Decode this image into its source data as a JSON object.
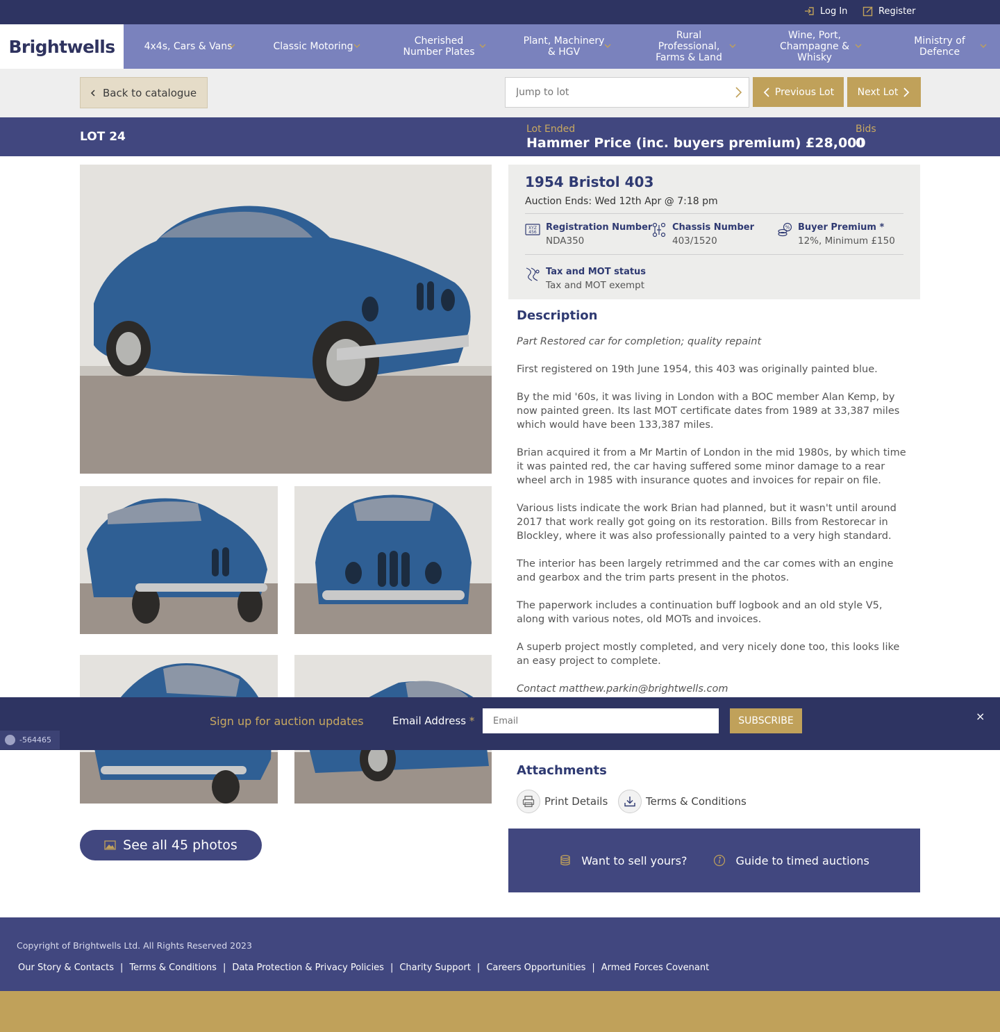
{
  "topbar": {
    "login_label": "Log In",
    "register_label": "Register"
  },
  "brand": {
    "logo_text": "Brightwells"
  },
  "nav": {
    "items": [
      {
        "label": "4x4s, Cars & Vans"
      },
      {
        "label": "Classic Motoring"
      },
      {
        "label": "Cherished Number Plates"
      },
      {
        "label": "Plant, Machinery & HGV"
      },
      {
        "label": "Rural Professional, Farms & Land"
      },
      {
        "label": "Wine, Port, Champagne & Whisky"
      },
      {
        "label": "Ministry of Defence"
      }
    ]
  },
  "subbar": {
    "back_label": "Back to catalogue",
    "jump_placeholder": "Jump to lot",
    "prev_label": "Previous Lot",
    "next_label": "Next Lot"
  },
  "lot": {
    "number": "LOT 24",
    "status_label": "Lot Ended",
    "hammer_text": "Hammer Price (inc. buyers premium) £28,000",
    "bids_label": "Bids",
    "bids_value": "0"
  },
  "vehicle": {
    "title": "1954 Bristol 403",
    "auction_ends": "Auction Ends: Wed 12th Apr @ 7:18 pm",
    "specs": {
      "registration": {
        "label": "Registration Number",
        "value": "NDA350"
      },
      "chassis": {
        "label": "Chassis Number",
        "value": "403/1520"
      },
      "premium": {
        "label": "Buyer Premium *",
        "value": "12%, Minimum £150"
      },
      "tax_mot": {
        "label": "Tax and MOT status",
        "value": "Tax and MOT exempt"
      }
    }
  },
  "description": {
    "heading": "Description",
    "paragraphs": [
      "Part Restored car for completion; quality repaint",
      "First registered on 19th June 1954, this 403 was originally painted blue.",
      "By the mid '60s, it was living in London with a BOC member Alan Kemp, by now painted green. Its last MOT certificate dates from 1989 at 33,387 miles which would have been 133,387 miles.",
      "Brian acquired it from a Mr Martin of London in the mid 1980s, by which time it was painted red, the car having suffered some minor damage to a rear wheel arch in 1985 with insurance quotes and invoices for repair on file.",
      "Various lists indicate the work Brian had planned, but it wasn't until around 2017 that work really got going on its restoration. Bills from Restorecar in Blockley, where it was also professionally painted to a very high standard.",
      "The interior has been largely retrimmed and the car comes with an engine and gearbox and the trim parts present in the photos.",
      "The paperwork includes a continuation buff logbook and an old style V5, along with various notes, old MOTs and invoices.",
      "A superb project mostly completed, and very nicely done too, this looks like an easy project to complete.",
      "Contact matthew.parkin@brightwells.com"
    ]
  },
  "attachments": {
    "heading": "Attachments",
    "print_label": "Print Details",
    "terms_label": "Terms & Conditions"
  },
  "cta": {
    "sell_label": "Want to sell yours?",
    "guide_label": "Guide to timed auctions"
  },
  "photos": {
    "see_all_label": "See all 45 photos"
  },
  "signup": {
    "heading": "Sign up for auction updates",
    "email_label": "Email Address",
    "required_mark": "*",
    "email_placeholder": "Email",
    "subscribe_label": "SUBSCRIBE",
    "close_symbol": "×"
  },
  "counter": {
    "value": "-564465"
  },
  "footer": {
    "copyright": "Copyright of Brightwells Ltd. All Rights Reserved 2023",
    "links": [
      "Our Story & Contacts",
      "Terms & Conditions",
      "Data Protection & Privacy Policies",
      "Charity Support",
      "Careers Opportunities",
      "Armed Forces Covenant"
    ],
    "separator": "|"
  },
  "colors": {
    "navy_dark": "#2e3462",
    "navy": "#41477f",
    "nav_light": "#7a82bd",
    "gold": "#c0a15a",
    "car_blue": "#2f5f94"
  }
}
